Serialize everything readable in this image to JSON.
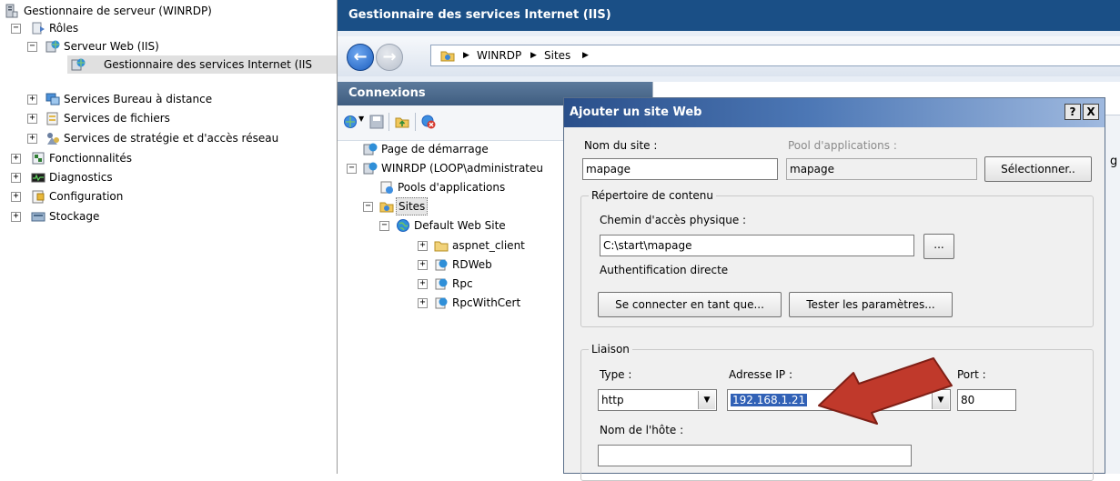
{
  "server_manager": {
    "title": "Gestionnaire de serveur (WINRDP)",
    "roles": "Rôles",
    "web_server": "Serveur Web (IIS)",
    "iis_manager": "Gestionnaire des services Internet (IIS",
    "remote_desktop": "Services Bureau à distance",
    "file_services": "Services de fichiers",
    "npas": "Services de stratégie et d'accès réseau",
    "features": "Fonctionnalités",
    "diagnostics": "Diagnostics",
    "configuration": "Configuration",
    "storage": "Stockage"
  },
  "iis": {
    "title": "Gestionnaire des services Internet (IIS)",
    "breadcrumb": [
      "WINRDP",
      "Sites"
    ],
    "connections_header": "Connexions",
    "tree": {
      "start_page": "Page de démarrage",
      "server": "WINRDP (LOOP\\administrateu",
      "app_pools": "Pools d'applications",
      "sites": "Sites",
      "default_site": "Default Web Site",
      "children": [
        "aspnet_client",
        "RDWeb",
        "Rpc",
        "RpcWithCert"
      ]
    },
    "content_partial_text": "g"
  },
  "dialog": {
    "title": "Ajouter un site Web",
    "help_btn": "?",
    "close_btn": "X",
    "site_name_label": "Nom du site :",
    "site_name_value": "mapage",
    "app_pool_label": "Pool d'applications :",
    "app_pool_value": "mapage",
    "select_btn": "Sélectionner..",
    "content_dir_group": "Répertoire de contenu",
    "physical_path_label": "Chemin d'accès physique :",
    "physical_path_value": "C:\\start\\mapage",
    "browse_btn": "...",
    "passthrough_auth": "Authentification directe",
    "connect_as_btn": "Se connecter en tant que...",
    "test_settings_btn": "Tester les paramètres...",
    "binding_group": "Liaison",
    "type_label": "Type :",
    "type_value": "http",
    "ip_label": "Adresse IP :",
    "ip_value": "192.168.1.21",
    "port_label": "Port :",
    "port_value": "80",
    "hostname_label": "Nom de l'hôte :",
    "hostname_value": ""
  },
  "colors": {
    "iis_title_bg": "#1a4f86",
    "dialog_title": "#2a4f8a",
    "selection": "#3161b6",
    "arrow": "#c0392b"
  }
}
